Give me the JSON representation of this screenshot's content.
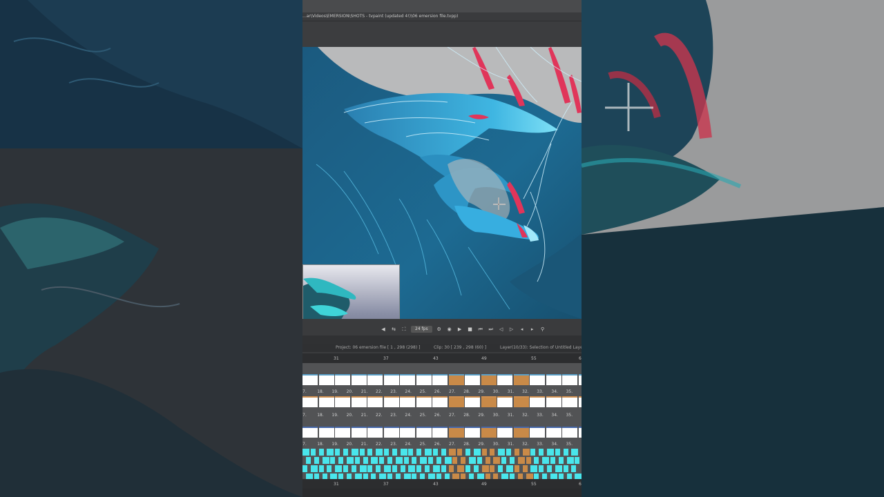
{
  "window": {
    "title": "...ar\\Videos\\EMERSION\\SHOTS - tvpaint (updated 4!)\\06 emersion file.tvpp)"
  },
  "icons": {
    "transport": [
      "speaker-icon",
      "loop-icon",
      "fullscreen-icon",
      "fps-field",
      "gear-icon",
      "onion-icon",
      "play-icon",
      "stop-icon",
      "first-frame-icon",
      "last-frame-icon",
      "step-back-icon",
      "step-forward-icon",
      "prev-key-icon",
      "next-key-icon",
      "pin-icon"
    ]
  },
  "transport": {
    "fps": "24 fps"
  },
  "status": {
    "project": "Project: 06 emersion file [ 1 , 298  (298) ]",
    "clip": "Clip: 30 [ 239 , 298  (60) ]",
    "layer": "Layer(10/33): Selection of Untitled Laye"
  },
  "ruler": {
    "labels": [
      "31",
      "37",
      "43",
      "49",
      "55",
      "6"
    ]
  },
  "timeline": {
    "frame_numbers": [
      "7.",
      "18.",
      "19.",
      "20.",
      "21.",
      "22.",
      "23.",
      "24.",
      "25.",
      "26.",
      "27.",
      "28.",
      "29.",
      "30.",
      "31.",
      "32.",
      "33.",
      "34.",
      "35."
    ]
  },
  "colors": {
    "wave_dark": "#1b5a7f",
    "wave_mid": "#2b8fc0",
    "wave_light": "#6fd6f4",
    "accent_red": "#e0355a",
    "timeline_orange": "#c98a48",
    "timeline_cyan": "#49e6ec"
  }
}
